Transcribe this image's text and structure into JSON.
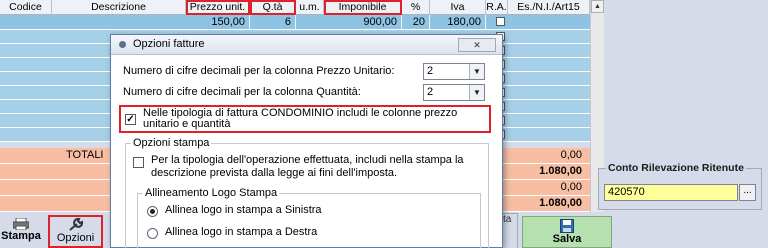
{
  "grid": {
    "columns": [
      "Codice",
      "Descrizione",
      "Prezzo unit.",
      "Q.tà",
      "u.m.",
      "Imponibile",
      "%",
      "Iva",
      "R.A.",
      "Es./N.I./Art15"
    ],
    "row1": {
      "prezzo": "150,00",
      "qta": "6",
      "imponibile": "900,00",
      "perc": "20",
      "iva": "180,00"
    }
  },
  "totals": {
    "label": "TOTALI",
    "values": [
      "0,00",
      "1.080,00",
      "0,00",
      "1.080,00"
    ]
  },
  "conto": {
    "label": "Conto Rilevazione Ritenute",
    "value": "420570",
    "button": "..."
  },
  "toolbar": {
    "stampa": "Stampa",
    "opzioni": "Opzioni",
    "salva": "Salva",
    "behind_text": "ta"
  },
  "dialog": {
    "title": "Opzioni fatture",
    "prezzo_label": "Numero di cifre decimali per la colonna Prezzo Unitario:",
    "prezzo_value": "2",
    "quantita_label": "Numero di cifre decimali per la colonna Quantità:",
    "quantita_value": "2",
    "condominio_line1": "Nelle tipologia di fattura CONDOMINIO includi le colonne prezzo",
    "condominio_line2": "unitario e quantità",
    "stampa_group": "Opzioni stampa",
    "stampa_line1": "Per la tipologia dell'operazione effettuata, includi nella stampa la",
    "stampa_line2": "descrizione prevista dalla legge ai fini dell'imposta.",
    "logo_group": "Allineamento Logo Stampa",
    "logo_left": "Allinea logo in stampa a Sinistra",
    "logo_right": "Allinea logo in stampa a Destra"
  },
  "colors": {
    "grid_row": "#a6cfe8",
    "totals_row": "#f8bea4",
    "highlight": "#e0202a",
    "conto_input": "#ffff99"
  }
}
